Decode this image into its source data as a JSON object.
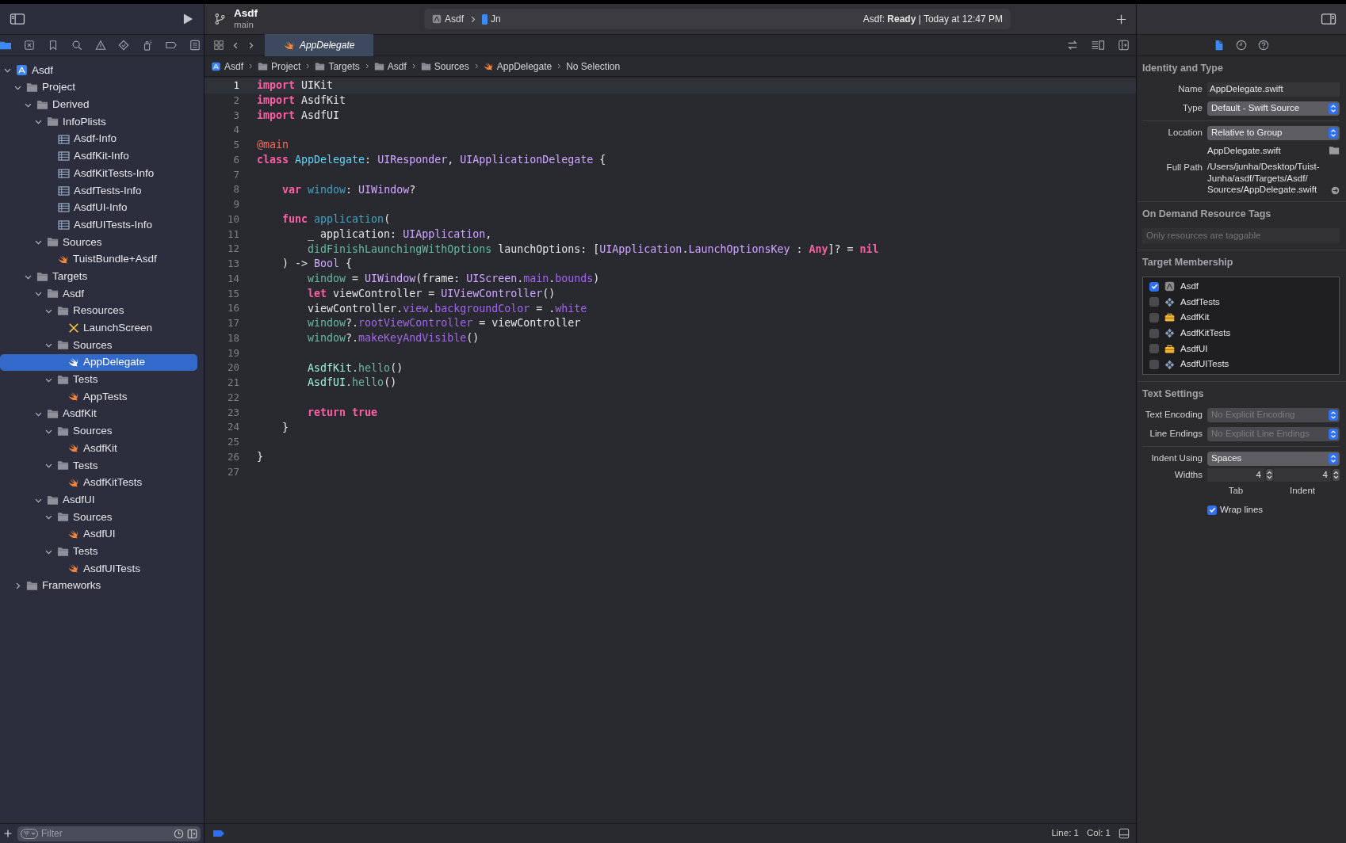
{
  "toolbar": {
    "project": "Asdf",
    "branch": "main",
    "scheme": "Asdf",
    "device": "Jn",
    "status": "Asdf: **Ready** | Today at 12:47 PM"
  },
  "navigator_tabs": [
    {
      "kind": "folder",
      "selected": true
    },
    {
      "kind": "source-control",
      "selected": false
    },
    {
      "kind": "bookmark",
      "selected": false
    },
    {
      "kind": "search",
      "selected": false
    },
    {
      "kind": "warning",
      "selected": false
    },
    {
      "kind": "test",
      "selected": false
    },
    {
      "kind": "debug",
      "selected": false
    },
    {
      "kind": "breakpoint",
      "selected": false
    },
    {
      "kind": "report",
      "selected": false
    }
  ],
  "tree": [
    {
      "label": "Asdf",
      "kind": "project",
      "expanded": true,
      "selected": false,
      "children": [
        {
          "label": "Project",
          "kind": "folder",
          "expanded": true,
          "selected": false,
          "children": [
            {
              "label": "Derived",
              "kind": "folder",
              "expanded": true,
              "selected": false,
              "children": [
                {
                  "label": "InfoPlists",
                  "kind": "folder",
                  "expanded": true,
                  "selected": false,
                  "children": [
                    {
                      "label": "Asdf-Info",
                      "kind": "plist",
                      "selected": false
                    },
                    {
                      "label": "AsdfKit-Info",
                      "kind": "plist",
                      "selected": false
                    },
                    {
                      "label": "AsdfKitTests-Info",
                      "kind": "plist",
                      "selected": false
                    },
                    {
                      "label": "AsdfTests-Info",
                      "kind": "plist",
                      "selected": false
                    },
                    {
                      "label": "AsdfUI-Info",
                      "kind": "plist",
                      "selected": false
                    },
                    {
                      "label": "AsdfUITests-Info",
                      "kind": "plist",
                      "selected": false
                    }
                  ]
                },
                {
                  "label": "Sources",
                  "kind": "folder",
                  "expanded": true,
                  "selected": false,
                  "children": [
                    {
                      "label": "TuistBundle+Asdf",
                      "kind": "swift",
                      "selected": false
                    }
                  ]
                }
              ]
            },
            {
              "label": "Targets",
              "kind": "folder",
              "expanded": true,
              "selected": false,
              "children": [
                {
                  "label": "Asdf",
                  "kind": "folder",
                  "expanded": true,
                  "selected": false,
                  "children": [
                    {
                      "label": "Resources",
                      "kind": "folder",
                      "expanded": true,
                      "selected": false,
                      "children": [
                        {
                          "label": "LaunchScreen",
                          "kind": "storyboard",
                          "selected": false
                        }
                      ]
                    },
                    {
                      "label": "Sources",
                      "kind": "folder",
                      "expanded": true,
                      "selected": false,
                      "children": [
                        {
                          "label": "AppDelegate",
                          "kind": "swift",
                          "selected": true
                        }
                      ]
                    },
                    {
                      "label": "Tests",
                      "kind": "folder",
                      "expanded": true,
                      "selected": false,
                      "children": [
                        {
                          "label": "AppTests",
                          "kind": "swift",
                          "selected": false
                        }
                      ]
                    }
                  ]
                },
                {
                  "label": "AsdfKit",
                  "kind": "folder",
                  "expanded": true,
                  "selected": false,
                  "children": [
                    {
                      "label": "Sources",
                      "kind": "folder",
                      "expanded": true,
                      "selected": false,
                      "children": [
                        {
                          "label": "AsdfKit",
                          "kind": "swift",
                          "selected": false
                        }
                      ]
                    },
                    {
                      "label": "Tests",
                      "kind": "folder",
                      "expanded": true,
                      "selected": false,
                      "children": [
                        {
                          "label": "AsdfKitTests",
                          "kind": "swift",
                          "selected": false
                        }
                      ]
                    }
                  ]
                },
                {
                  "label": "AsdfUI",
                  "kind": "folder",
                  "expanded": true,
                  "selected": false,
                  "children": [
                    {
                      "label": "Sources",
                      "kind": "folder",
                      "expanded": true,
                      "selected": false,
                      "children": [
                        {
                          "label": "AsdfUI",
                          "kind": "swift",
                          "selected": false
                        }
                      ]
                    },
                    {
                      "label": "Tests",
                      "kind": "folder",
                      "expanded": true,
                      "selected": false,
                      "children": [
                        {
                          "label": "AsdfUITests",
                          "kind": "swift",
                          "selected": false
                        }
                      ]
                    }
                  ]
                }
              ]
            }
          ]
        },
        {
          "label": "Frameworks",
          "kind": "folder",
          "expanded": false,
          "selected": false
        }
      ]
    }
  ],
  "navigator_filter": {
    "placeholder": "Filter"
  },
  "editor_tabs": [
    {
      "label": "AppDelegate",
      "kind": "swift",
      "selected": true,
      "preview": true
    }
  ],
  "breadcrumb": [
    {
      "label": "Asdf",
      "kind": "project"
    },
    {
      "label": "Project",
      "kind": "folder"
    },
    {
      "label": "Targets",
      "kind": "folder"
    },
    {
      "label": "Asdf",
      "kind": "folder"
    },
    {
      "label": "Sources",
      "kind": "folder"
    },
    {
      "label": "AppDelegate",
      "kind": "swift"
    },
    {
      "label": "No Selection",
      "kind": "text"
    }
  ],
  "code_lines": [
    {
      "number": "1",
      "current": true,
      "tokens": [
        {
          "text": "import",
          "kind": "keyword"
        },
        {
          "text": " UIKit",
          "kind": "plain"
        }
      ]
    },
    {
      "number": "2",
      "current": false,
      "tokens": [
        {
          "text": "import",
          "kind": "keyword"
        },
        {
          "text": " AsdfKit",
          "kind": "plain"
        }
      ]
    },
    {
      "number": "3",
      "current": false,
      "tokens": [
        {
          "text": "import",
          "kind": "keyword"
        },
        {
          "text": " AsdfUI",
          "kind": "plain"
        }
      ]
    },
    {
      "number": "4",
      "current": false
    },
    {
      "number": "5",
      "current": false,
      "tokens": [
        {
          "text": "@main",
          "kind": "attribute"
        }
      ]
    },
    {
      "number": "6",
      "current": false,
      "tokens": [
        {
          "text": "class",
          "kind": "keyword"
        },
        {
          "text": " AppDelegate",
          "kind": "type-declaration"
        },
        {
          "text": ": ",
          "kind": "plain"
        },
        {
          "text": "UIResponder",
          "kind": "system-type"
        },
        {
          "text": ", ",
          "kind": "plain"
        },
        {
          "text": "UIApplicationDelegate",
          "kind": "system-type"
        },
        {
          "text": " {",
          "kind": "plain"
        }
      ]
    },
    {
      "number": "7",
      "current": false
    },
    {
      "number": "8",
      "current": false,
      "tokens": [
        {
          "text": "    var",
          "kind": "keyword"
        },
        {
          "text": " window",
          "kind": "declaration"
        },
        {
          "text": ": ",
          "kind": "plain"
        },
        {
          "text": "UIWindow",
          "kind": "system-type"
        },
        {
          "text": "?",
          "kind": "plain"
        }
      ]
    },
    {
      "number": "9",
      "current": false
    },
    {
      "number": "10",
      "current": false,
      "tokens": [
        {
          "text": "    func",
          "kind": "keyword"
        },
        {
          "text": " application",
          "kind": "declaration"
        },
        {
          "text": "(",
          "kind": "plain"
        }
      ]
    },
    {
      "number": "11",
      "current": false,
      "tokens": [
        {
          "text": "        _ application: ",
          "kind": "plain"
        },
        {
          "text": "UIApplication",
          "kind": "system-type"
        },
        {
          "text": ",",
          "kind": "plain"
        }
      ]
    },
    {
      "number": "12",
      "current": false,
      "tokens": [
        {
          "text": "        didFinishLaunchingWithOptions",
          "kind": "project-member"
        },
        {
          "text": " launchOptions: [",
          "kind": "plain"
        },
        {
          "text": "UIApplication",
          "kind": "system-type"
        },
        {
          "text": ".",
          "kind": "plain"
        },
        {
          "text": "LaunchOptionsKey",
          "kind": "system-type"
        },
        {
          "text": " : ",
          "kind": "plain"
        },
        {
          "text": "Any",
          "kind": "keyword"
        },
        {
          "text": "]? = ",
          "kind": "plain"
        },
        {
          "text": "nil",
          "kind": "keyword"
        }
      ]
    },
    {
      "number": "13",
      "current": false,
      "tokens": [
        {
          "text": "    ) -> ",
          "kind": "plain"
        },
        {
          "text": "Bool",
          "kind": "system-type"
        },
        {
          "text": " {",
          "kind": "plain"
        }
      ]
    },
    {
      "number": "14",
      "current": false,
      "tokens": [
        {
          "text": "        window",
          "kind": "project-member"
        },
        {
          "text": " = ",
          "kind": "plain"
        },
        {
          "text": "UIWindow",
          "kind": "system-type"
        },
        {
          "text": "(frame: ",
          "kind": "plain"
        },
        {
          "text": "UIScreen",
          "kind": "system-type"
        },
        {
          "text": ".",
          "kind": "plain"
        },
        {
          "text": "main",
          "kind": "system-member"
        },
        {
          "text": ".",
          "kind": "plain"
        },
        {
          "text": "bounds",
          "kind": "system-member"
        },
        {
          "text": ")",
          "kind": "plain"
        }
      ]
    },
    {
      "number": "15",
      "current": false,
      "tokens": [
        {
          "text": "        let",
          "kind": "keyword"
        },
        {
          "text": " viewController = ",
          "kind": "plain"
        },
        {
          "text": "UIViewController",
          "kind": "system-type"
        },
        {
          "text": "()",
          "kind": "plain"
        }
      ]
    },
    {
      "number": "16",
      "current": false,
      "tokens": [
        {
          "text": "        viewController.",
          "kind": "plain"
        },
        {
          "text": "view",
          "kind": "system-member"
        },
        {
          "text": ".",
          "kind": "plain"
        },
        {
          "text": "backgroundColor",
          "kind": "system-member"
        },
        {
          "text": " = .",
          "kind": "plain"
        },
        {
          "text": "white",
          "kind": "system-member"
        }
      ]
    },
    {
      "number": "17",
      "current": false,
      "tokens": [
        {
          "text": "        window",
          "kind": "project-member"
        },
        {
          "text": "?.",
          "kind": "plain"
        },
        {
          "text": "rootViewController",
          "kind": "system-member"
        },
        {
          "text": " = viewController",
          "kind": "plain"
        }
      ]
    },
    {
      "number": "18",
      "current": false,
      "tokens": [
        {
          "text": "        window",
          "kind": "project-member"
        },
        {
          "text": "?.",
          "kind": "plain"
        },
        {
          "text": "makeKeyAndVisible",
          "kind": "system-member"
        },
        {
          "text": "()",
          "kind": "plain"
        }
      ]
    },
    {
      "number": "19",
      "current": false
    },
    {
      "number": "20",
      "current": false,
      "tokens": [
        {
          "text": "        AsdfKit.",
          "kind": "project-type"
        },
        {
          "text": "hello",
          "kind": "project-member"
        },
        {
          "text": "()",
          "kind": "plain"
        }
      ]
    },
    {
      "number": "21",
      "current": false,
      "tokens": [
        {
          "text": "        AsdfUI.",
          "kind": "project-type"
        },
        {
          "text": "hello",
          "kind": "project-member"
        },
        {
          "text": "()",
          "kind": "plain"
        }
      ]
    },
    {
      "number": "22",
      "current": false
    },
    {
      "number": "23",
      "current": false,
      "tokens": [
        {
          "text": "        return",
          "kind": "keyword"
        },
        {
          "text": " true",
          "kind": "keyword"
        }
      ]
    },
    {
      "number": "24",
      "current": false,
      "tokens": [
        {
          "text": "    }",
          "kind": "plain"
        }
      ]
    },
    {
      "number": "25",
      "current": false
    },
    {
      "number": "26",
      "current": false,
      "tokens": [
        {
          "text": "}",
          "kind": "plain"
        }
      ]
    },
    {
      "number": "27",
      "current": false
    }
  ],
  "status_bar": {
    "line": "Line: 1",
    "column": "Col: 1"
  },
  "inspector": {
    "tabs": [
      {
        "kind": "file",
        "selected": true
      },
      {
        "kind": "history",
        "selected": false
      },
      {
        "kind": "help",
        "selected": false
      }
    ],
    "identity": {
      "title": "Identity and Type",
      "name": {
        "label": "Name",
        "value": "AppDelegate.swift"
      },
      "type": {
        "label": "Type",
        "value": "Default - Swift Source",
        "disabled": false
      },
      "location": {
        "label": "Location",
        "value": "Relative to Group",
        "disabled": false
      },
      "file_name": "AppDelegate.swift",
      "full_path": {
        "label": "Full Path",
        "lines": [
          "/Users/junha/Desktop/Tuist-",
          "Junha/asdf/Targets/Asdf/",
          "Sources/AppDelegate.swift"
        ]
      }
    },
    "resource_tags": {
      "title": "On Demand Resource Tags",
      "placeholder": "Only resources are taggable"
    },
    "target_membership": {
      "title": "Target Membership",
      "targets": [
        {
          "name": "Asdf",
          "kind": "app",
          "checked": true
        },
        {
          "name": "AsdfTests",
          "kind": "test",
          "checked": false
        },
        {
          "name": "AsdfKit",
          "kind": "framework",
          "checked": false
        },
        {
          "name": "AsdfKitTests",
          "kind": "test",
          "checked": false
        },
        {
          "name": "AsdfUI",
          "kind": "framework",
          "checked": false
        },
        {
          "name": "AsdfUITests",
          "kind": "test",
          "checked": false
        }
      ]
    },
    "text_settings": {
      "title": "Text Settings",
      "encoding": {
        "label": "Text Encoding",
        "value": "No Explicit Encoding",
        "disabled": true
      },
      "line_endings": {
        "label": "Line Endings",
        "value": "No Explicit Line Endings",
        "disabled": true
      },
      "indent_using": {
        "label": "Indent Using",
        "value": "Spaces",
        "disabled": false
      },
      "widths_label": "Widths",
      "tab": {
        "value": "4",
        "label": "Tab"
      },
      "indent": {
        "value": "4",
        "label": "Indent"
      },
      "wrap_lines": {
        "label": "Wrap lines",
        "checked": true
      }
    }
  }
}
